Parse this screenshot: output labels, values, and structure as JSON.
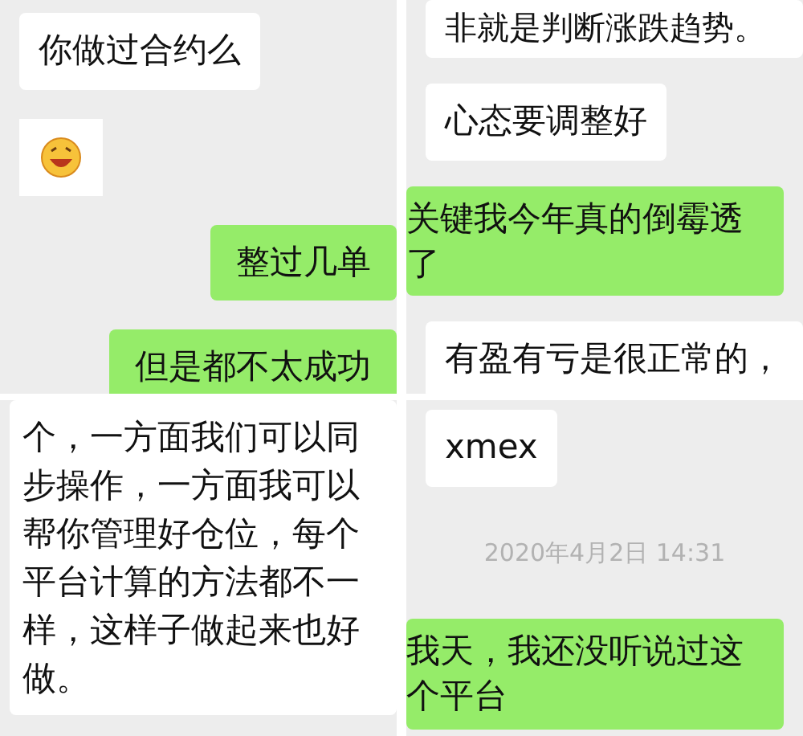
{
  "panels": [
    {
      "messages": [
        {
          "kind": "text",
          "outgoing": false,
          "text": "你做过合约么"
        },
        {
          "kind": "emoji",
          "outgoing": false
        },
        {
          "kind": "text",
          "outgoing": true,
          "text": "整过几单"
        },
        {
          "kind": "text",
          "outgoing": true,
          "text": "但是都不太成功"
        }
      ]
    },
    {
      "messages": [
        {
          "kind": "text",
          "outgoing": false,
          "text": "非就是判断涨跌趋势。"
        },
        {
          "kind": "text",
          "outgoing": false,
          "text": "心态要调整好"
        },
        {
          "kind": "text",
          "outgoing": true,
          "text": "关键我今年真的倒霉透了"
        },
        {
          "kind": "text",
          "outgoing": false,
          "text": "有盈有亏是很正常的，"
        }
      ]
    },
    {
      "messages": [
        {
          "kind": "text",
          "outgoing": false,
          "text": "个，一方面我们可以同步操作，一方面我可以帮你管理好仓位，每个平台计算的方法都不一样，这样子做起来也好做。"
        }
      ]
    },
    {
      "messages": [
        {
          "kind": "text",
          "outgoing": false,
          "text": "xmex"
        },
        {
          "kind": "timestamp",
          "text": "2020年4月2日 14:31"
        },
        {
          "kind": "text",
          "outgoing": true,
          "text": "我天，我还没听说过这个平台"
        }
      ]
    }
  ]
}
